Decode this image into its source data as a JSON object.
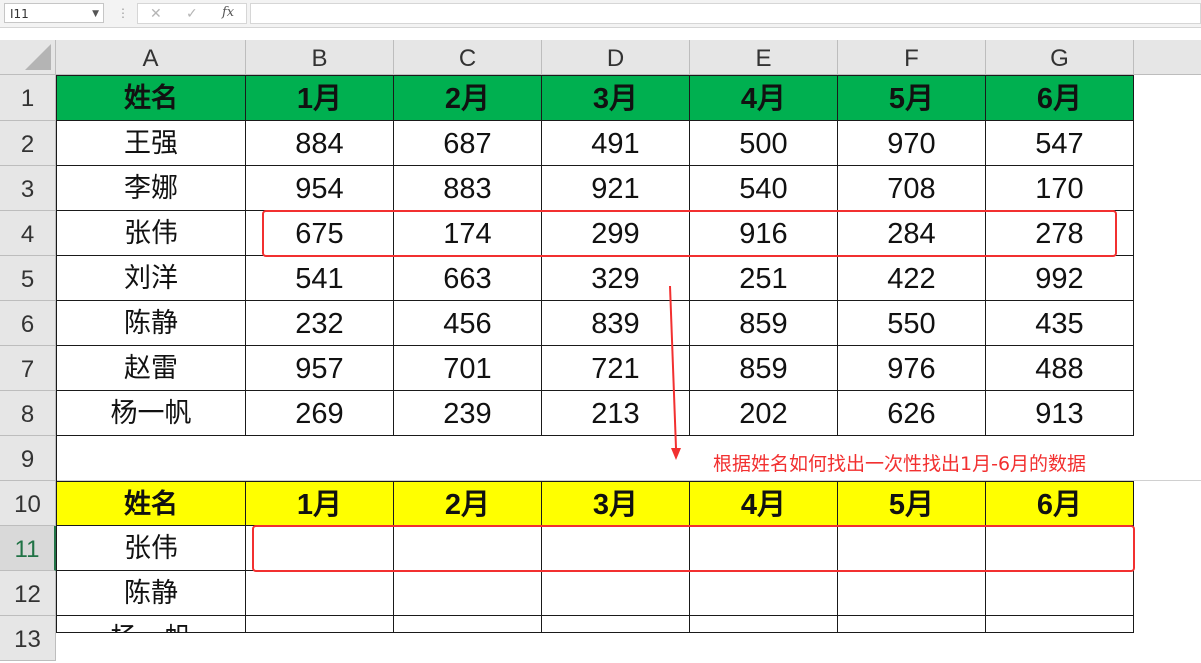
{
  "formula_bar": {
    "name_box": "I11",
    "cancel_icon": "✕",
    "enter_icon": "✓",
    "fx_label": "fx",
    "formula": ""
  },
  "columns": [
    "A",
    "B",
    "C",
    "D",
    "E",
    "F",
    "G"
  ],
  "rows": [
    "1",
    "2",
    "3",
    "4",
    "5",
    "6",
    "7",
    "8",
    "9",
    "10",
    "11",
    "12",
    "13"
  ],
  "table1": {
    "header": [
      "姓名",
      "1月",
      "2月",
      "3月",
      "4月",
      "5月",
      "6月"
    ],
    "rows": [
      [
        "王强",
        "884",
        "687",
        "491",
        "500",
        "970",
        "547"
      ],
      [
        "李娜",
        "954",
        "883",
        "921",
        "540",
        "708",
        "170"
      ],
      [
        "张伟",
        "675",
        "174",
        "299",
        "916",
        "284",
        "278"
      ],
      [
        "刘洋",
        "541",
        "663",
        "329",
        "251",
        "422",
        "992"
      ],
      [
        "陈静",
        "232",
        "456",
        "839",
        "859",
        "550",
        "435"
      ],
      [
        "赵雷",
        "957",
        "701",
        "721",
        "859",
        "976",
        "488"
      ],
      [
        "杨一帆",
        "269",
        "239",
        "213",
        "202",
        "626",
        "913"
      ]
    ]
  },
  "annotation": "根据姓名如何找出一次性找出1月-6月的数据",
  "table2": {
    "header": [
      "姓名",
      "1月",
      "2月",
      "3月",
      "4月",
      "5月",
      "6月"
    ],
    "names": [
      "张伟",
      "陈静",
      "杨一帆"
    ]
  },
  "colors": {
    "green_header": "#00b050",
    "yellow_header": "#ffff00",
    "highlight": "#f23030",
    "active_row": "#217346"
  }
}
